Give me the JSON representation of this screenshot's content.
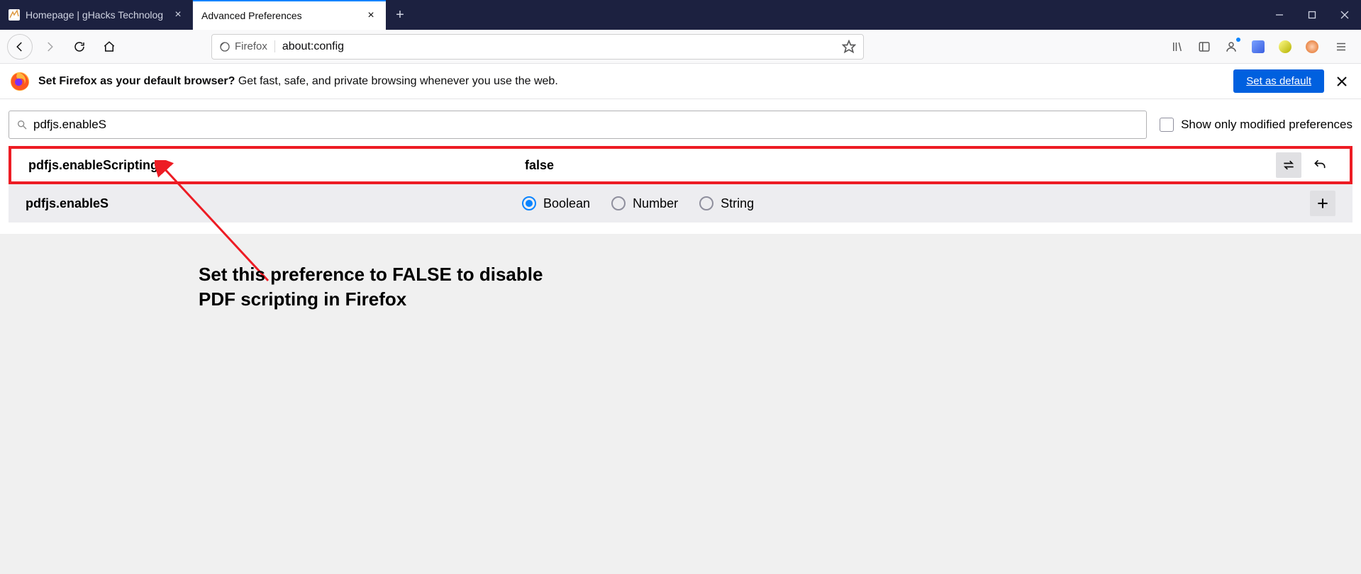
{
  "tabs": {
    "inactive": {
      "title": "Homepage | gHacks Technolog"
    },
    "active": {
      "title": "Advanced Preferences"
    }
  },
  "addressbar": {
    "identity": "Firefox",
    "url": "about:config"
  },
  "notification": {
    "bold": "Set Firefox as your default browser?",
    "rest": " Get fast, safe, and private browsing whenever you use the web.",
    "button": "Set as default"
  },
  "config": {
    "search_value": "pdfjs.enableS",
    "show_modified_label": "Show only modified preferences",
    "row1": {
      "name": "pdfjs.enableScripting",
      "value": "false"
    },
    "row2": {
      "name": "pdfjs.enableS",
      "opt_boolean": "Boolean",
      "opt_number": "Number",
      "opt_string": "String"
    }
  },
  "annotation": "Set this preference to FALSE to disable PDF scripting in Firefox"
}
